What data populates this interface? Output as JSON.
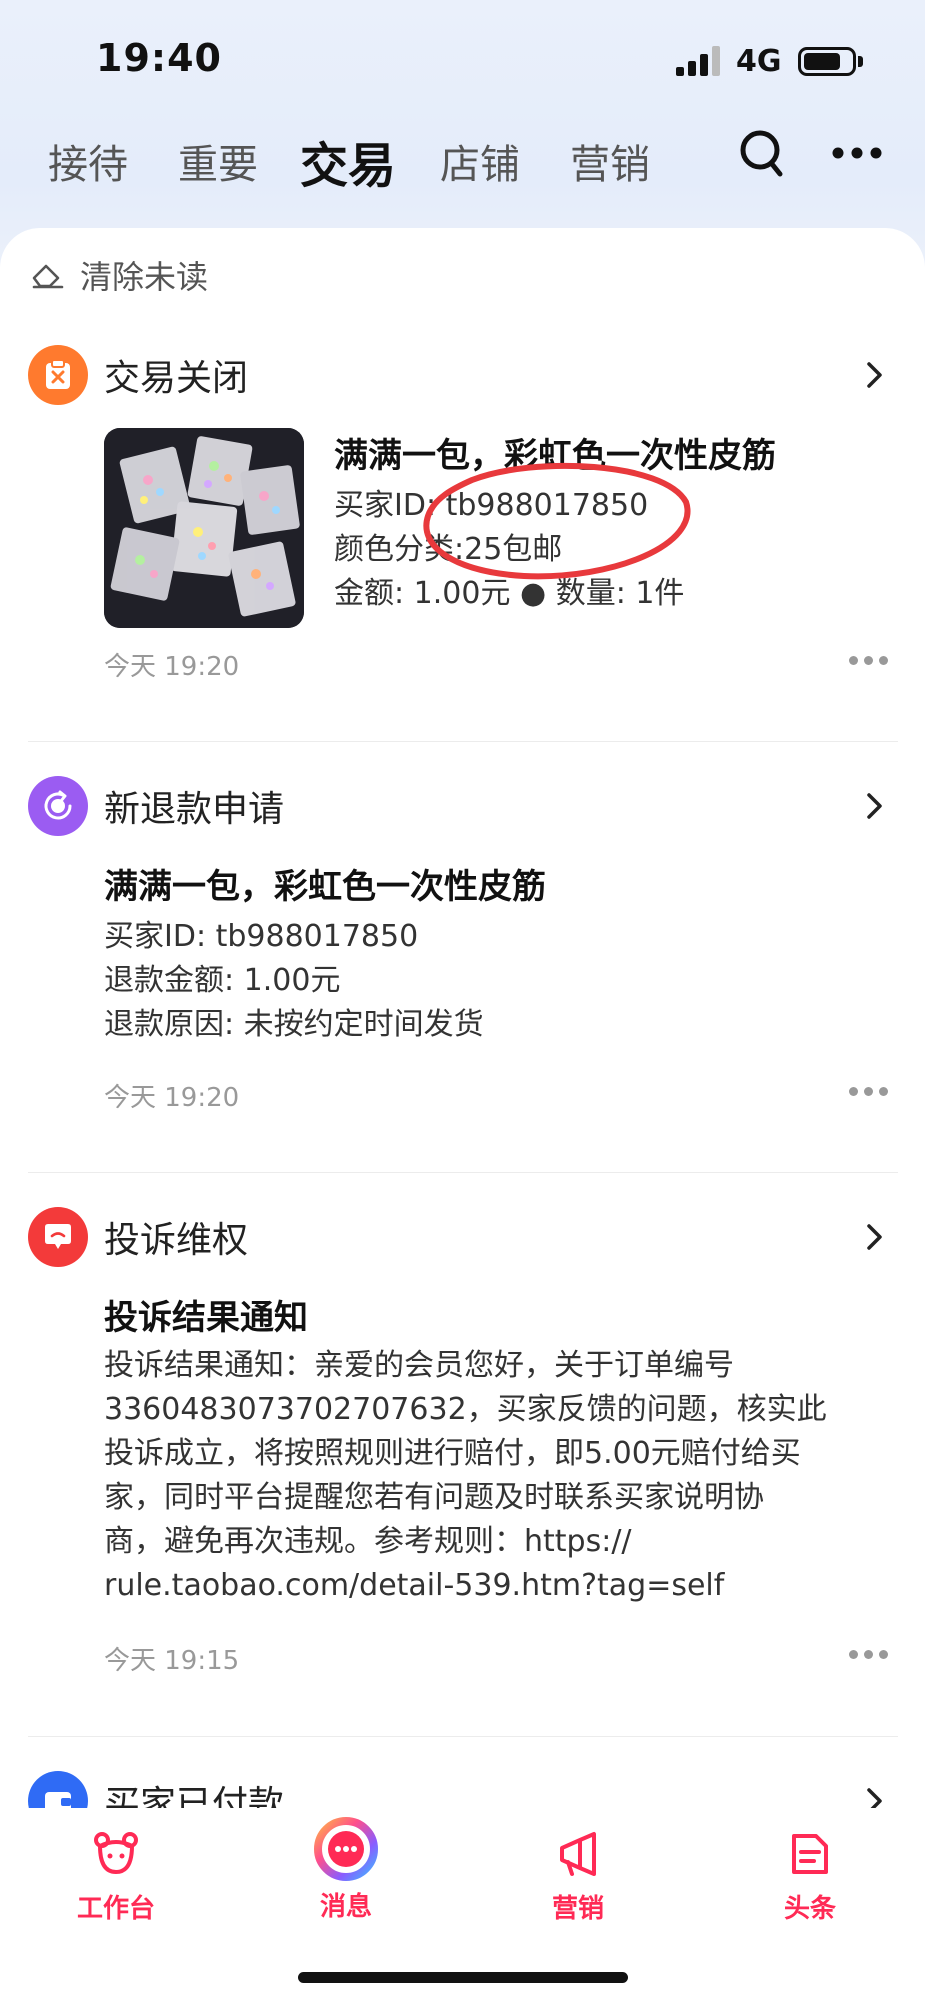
{
  "status_bar": {
    "time": "19:40",
    "network": "4G",
    "battery_level": 0.7
  },
  "tabs": [
    {
      "label": "接待",
      "active": false
    },
    {
      "label": "重要",
      "active": false
    },
    {
      "label": "交易",
      "active": true
    },
    {
      "label": "店铺",
      "active": false
    },
    {
      "label": "营销",
      "active": false
    }
  ],
  "header_icons": [
    "search-icon",
    "more-icon"
  ],
  "clear_unread": {
    "label": "清除未读",
    "icon": "eraser-icon"
  },
  "sections": [
    {
      "title": "交易关闭",
      "icon": "trade-closed-icon",
      "icon_color": "#ff7a2e",
      "item_title": "满满一包，彩虹色一次性皮筋",
      "lines": [
        "买家ID: tb988017850",
        "颜色分类:25包邮",
        "金额: 1.00元 ● 数量: 1件"
      ],
      "time": "今天 19:20"
    },
    {
      "title": "新退款申请",
      "icon": "refund-icon",
      "icon_color": "#9b5cf2",
      "item_title": "满满一包，彩虹色一次性皮筋",
      "lines": [
        "买家ID: tb988017850",
        "退款金额: 1.00元",
        "退款原因: 未按约定时间发货"
      ],
      "time": "今天 19:20"
    },
    {
      "title": "投诉维权",
      "icon": "complaint-icon",
      "icon_color": "#f33a3a",
      "item_title": "投诉结果通知",
      "lines": [
        "投诉结果通知：亲爱的会员您好，关于订单编号",
        "3360483073702707632，买家反馈的问题，核实此",
        "投诉成立，将按照规则进行赔付，即5.00元赔付给买",
        "家，同时平台提醒您若有问题及时联系买家说明协",
        "商，避免再次违规。参考规则：https://",
        "rule.taobao.com/detail-539.htm?tag=self"
      ],
      "time": "今天 19:15"
    },
    {
      "title": "买家已付款",
      "icon": "paid-icon",
      "icon_color": "#2f6bf5"
    }
  ],
  "bottom_nav": [
    {
      "label": "工作台",
      "icon": "workbench-icon"
    },
    {
      "label": "消息",
      "icon": "message-icon"
    },
    {
      "label": "营销",
      "icon": "marketing-icon"
    },
    {
      "label": "头条",
      "icon": "headline-icon"
    }
  ],
  "colors": {
    "accent": "#ff2a55",
    "annotation": "#e8393c"
  }
}
